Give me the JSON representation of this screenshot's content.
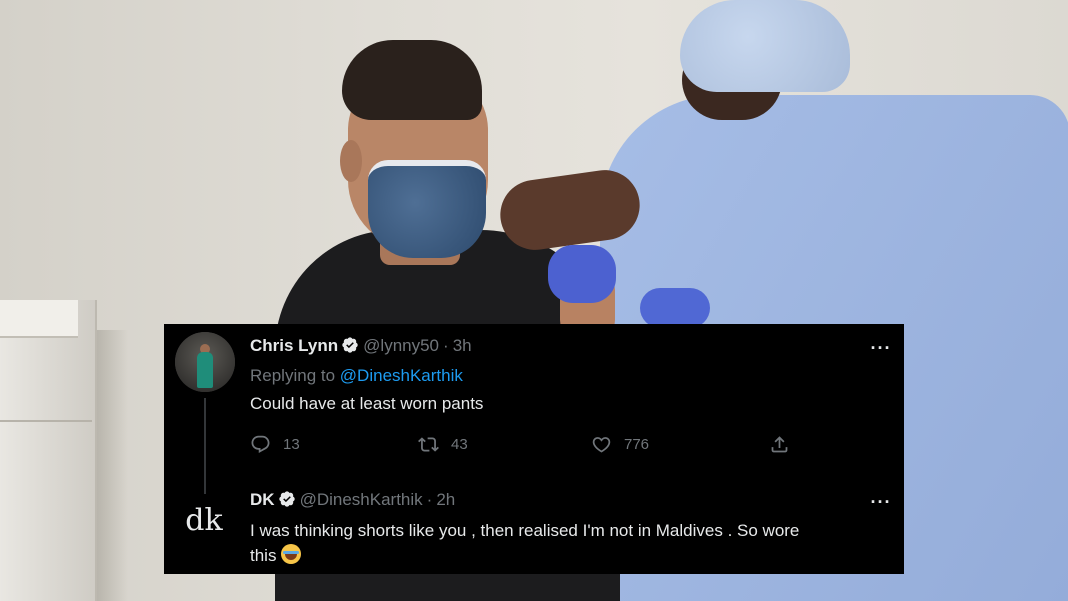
{
  "tweet1": {
    "name": "Chris Lynn",
    "handle": "@lynny50",
    "sep": "·",
    "time": "3h",
    "replying_prefix": "Replying to",
    "replying_to": "@DineshKarthik",
    "text": "Could have at least worn pants",
    "stats": {
      "replies": "13",
      "retweets": "43",
      "likes": "776"
    }
  },
  "tweet2": {
    "name": "DK",
    "handle": "@DineshKarthik",
    "sep": "·",
    "time": "2h",
    "logo_text": "dk",
    "text_line1": "I was thinking shorts like you , then realised I'm not in Maldives . So wore",
    "text_line2": "this"
  },
  "more_glyph": "···",
  "icons": {
    "verified": "verified-badge-icon",
    "reply": "reply-icon",
    "retweet": "retweet-icon",
    "like": "heart-icon",
    "share": "share-icon",
    "emoji": "face-with-tears-of-joy-emoji"
  },
  "colors": {
    "card_bg": "#000000",
    "text": "#e7e9ea",
    "muted": "#71767b",
    "link": "#1d9bf0"
  }
}
